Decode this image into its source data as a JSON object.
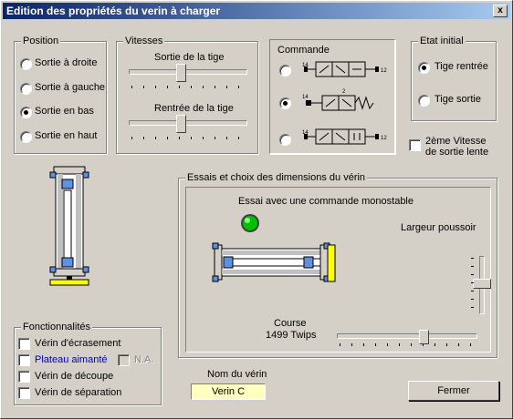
{
  "window": {
    "title": "Edition des propriétés du verin à charger",
    "close_label": "x"
  },
  "position": {
    "label": "Position",
    "options": [
      "Sortie à droite",
      "Sortie à gauche",
      "Sortie en bas",
      "Sortie en haut"
    ],
    "selected": "Sortie en bas"
  },
  "vitesses": {
    "label": "Vitesses",
    "sortie_label": "Sortie de la tige",
    "rentree_label": "Rentrée de la tige"
  },
  "commande": {
    "label": "Commande",
    "valve_port_labels": [
      "14",
      "12",
      "2",
      "4",
      "1",
      "3",
      "5"
    ],
    "selected_index": 1
  },
  "etat_initial": {
    "label": "Etat initial",
    "options": [
      "Tige rentrée",
      "Tige sortie"
    ],
    "selected": "Tige rentrée"
  },
  "vitesse_lente": {
    "label_line1": "2ème Vitesse",
    "label_line2": "de sortie lente",
    "checked": false
  },
  "essais": {
    "label": "Essais et choix des dimensions du vérin",
    "essai_text": "Essai avec une commande monostable",
    "largeur_label": "Largeur poussoir",
    "course_label": "Course",
    "course_value": "1499 Twips",
    "indicator_color": "#00c000"
  },
  "fonctionnalites": {
    "label": "Fonctionnalités",
    "items": [
      "Vérin d'écrasement",
      "Plateau aimanté",
      "Vérin de découpe",
      "Vérin de séparation"
    ],
    "na_label": "N.A.",
    "highlight_color": "#0000c0"
  },
  "nom": {
    "label": "Nom du vérin",
    "value": "Verin C",
    "field_color": "#ffffc0"
  },
  "fermer_label": "Fermer"
}
